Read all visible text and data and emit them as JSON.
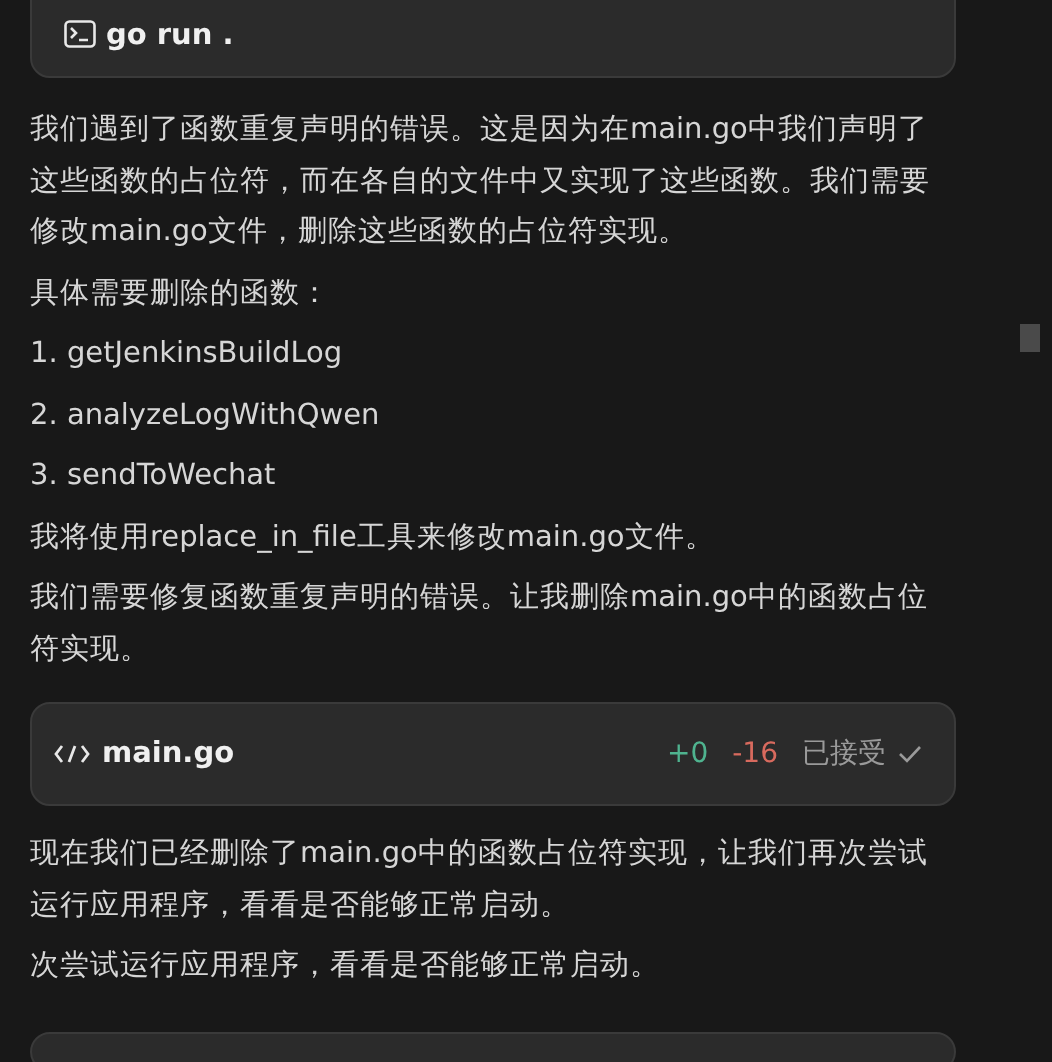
{
  "blocks": [
    {
      "kind": "command",
      "label": "go run ."
    },
    {
      "kind": "text",
      "text": "我们遇到了函数重复声明的错误。这是因为在main.go中我们声明了这些函数的占位符，而在各自的文件中又实现了这些函数。我们需要修改main.go文件，删除这些函数的占位符实现。"
    },
    {
      "kind": "text",
      "text": "具体需要删除的函数："
    },
    {
      "kind": "text",
      "text": "1. getJenkinsBuildLog"
    },
    {
      "kind": "text",
      "text": "2. analyzeLogWithQwen"
    },
    {
      "kind": "text",
      "text": "3. sendToWechat"
    },
    {
      "kind": "text",
      "text": "我将使用replace_in_file工具来修改main.go文件。"
    },
    {
      "kind": "text",
      "text": "我们需要修复函数重复声明的错误。让我删除main.go中的函数占位符实现。"
    },
    {
      "kind": "file",
      "label": "main.go",
      "added": "+0",
      "removed": "-16",
      "status": "已接受"
    },
    {
      "kind": "text",
      "text": "现在我们已经删除了main.go中的函数占位符实现，让我们再次尝试运行应用程序，看看是否能够正常启动。"
    },
    {
      "kind": "text",
      "text": "次尝试运行应用程序，看看是否能够正常启动。"
    },
    {
      "kind": "command"
    }
  ]
}
